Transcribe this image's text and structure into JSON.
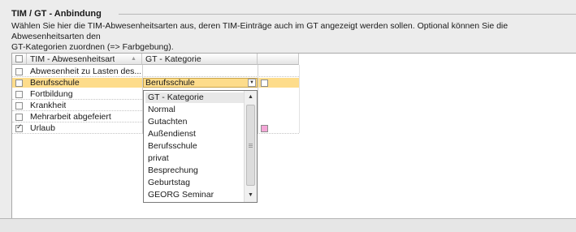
{
  "group": {
    "title": "TIM / GT - Anbindung",
    "description": "Wählen Sie hier die TIM-Abwesenheitsarten aus, deren TIM-Einträge auch im GT angezeigt werden sollen. Optional können Sie die Abwesenheitsarten den\nGT-Kategorien zuordnen (=> Farbgebung)."
  },
  "grid": {
    "columns": {
      "absence_type": "TIM - Abwesenheitsart",
      "category": "GT - Kategorie"
    },
    "rows": [
      {
        "name": "Abwesenheit zu Lasten des...",
        "checked": false,
        "category": "",
        "color": ""
      },
      {
        "name": "Berufsschule",
        "checked": false,
        "category": "Berufsschule",
        "color": "#ffffff",
        "selected": true
      },
      {
        "name": "Fortbildung",
        "checked": false,
        "category": "",
        "color": ""
      },
      {
        "name": "Krankheit",
        "checked": false,
        "category": "",
        "color": ""
      },
      {
        "name": "Mehrarbeit abgefeiert",
        "checked": false,
        "category": "",
        "color": ""
      },
      {
        "name": "Urlaub",
        "checked": true,
        "category": "",
        "color": "#f4a6d7"
      }
    ]
  },
  "dropdown": {
    "items": [
      "GT - Kategorie",
      "Normal",
      "Gutachten",
      "Außendienst",
      "Berufsschule",
      "privat",
      "Besprechung",
      "Geburtstag",
      "GEORG Seminar"
    ]
  },
  "colors": {
    "selection": "#fddc8b",
    "urlaub_swatch": "#f4a6d7"
  }
}
